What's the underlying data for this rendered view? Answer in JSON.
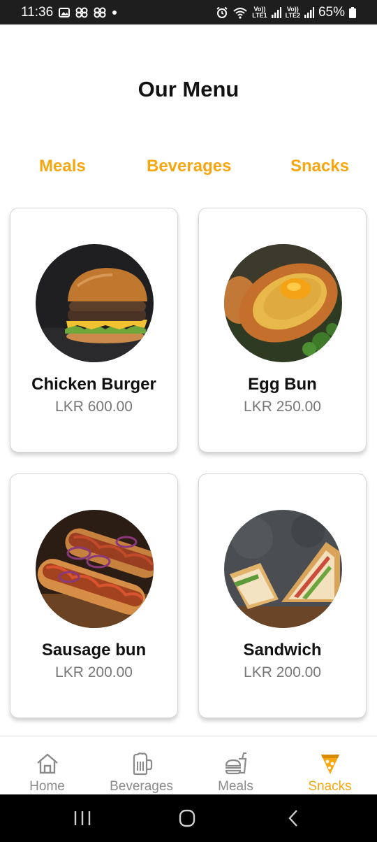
{
  "status_bar": {
    "time": "11:36",
    "battery": "65%",
    "lte1": "Vo))\nLTE1",
    "lte2": "Vo))\nLTE2"
  },
  "page": {
    "title": "Our Menu"
  },
  "tabs": [
    {
      "label": "Meals"
    },
    {
      "label": "Beverages"
    },
    {
      "label": "Snacks"
    }
  ],
  "accent_color": "#F5A712",
  "items": [
    {
      "name": "Chicken Burger",
      "price": "LKR 600.00",
      "image": "burger-photo"
    },
    {
      "name": "Egg Bun",
      "price": "LKR 250.00",
      "image": "egg-bun-photo"
    },
    {
      "name": "Sausage bun",
      "price": "LKR 200.00",
      "image": "sausage-bun-photo"
    },
    {
      "name": "Sandwich",
      "price": "LKR 200.00",
      "image": "sandwich-photo"
    }
  ],
  "bottom_nav": [
    {
      "label": "Home",
      "icon": "home-icon"
    },
    {
      "label": "Beverages",
      "icon": "beer-mug-icon"
    },
    {
      "label": "Meals",
      "icon": "burger-drink-icon"
    },
    {
      "label": "Snacks",
      "icon": "pizza-slice-icon",
      "active": true
    }
  ]
}
